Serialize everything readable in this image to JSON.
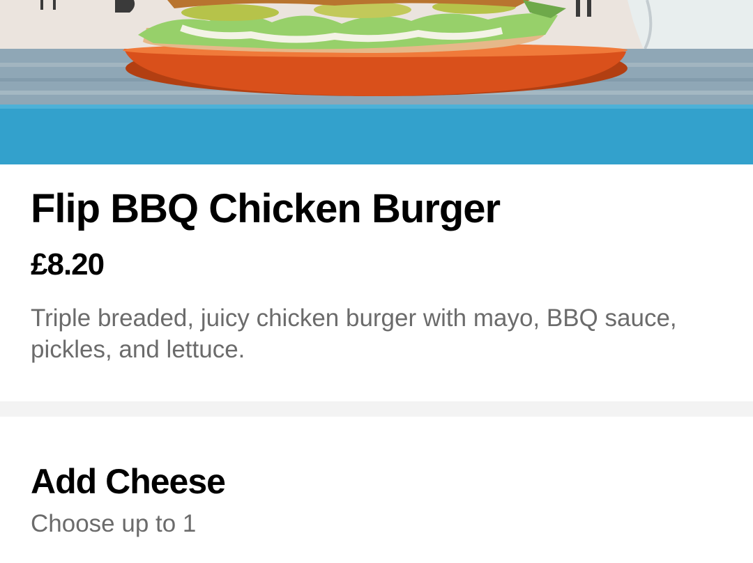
{
  "item": {
    "name": "Flip BBQ Chicken Burger",
    "price": "£8.20",
    "description": "Triple breaded, juicy chicken burger with mayo, BBQ sauce, pickles, and lettuce."
  },
  "options": [
    {
      "title": "Add Cheese",
      "subtitle": "Choose up to 1"
    }
  ],
  "colors": {
    "plate": "#e2571f",
    "counter": "#33a1cc",
    "secondary_text": "#6b6b6b"
  }
}
